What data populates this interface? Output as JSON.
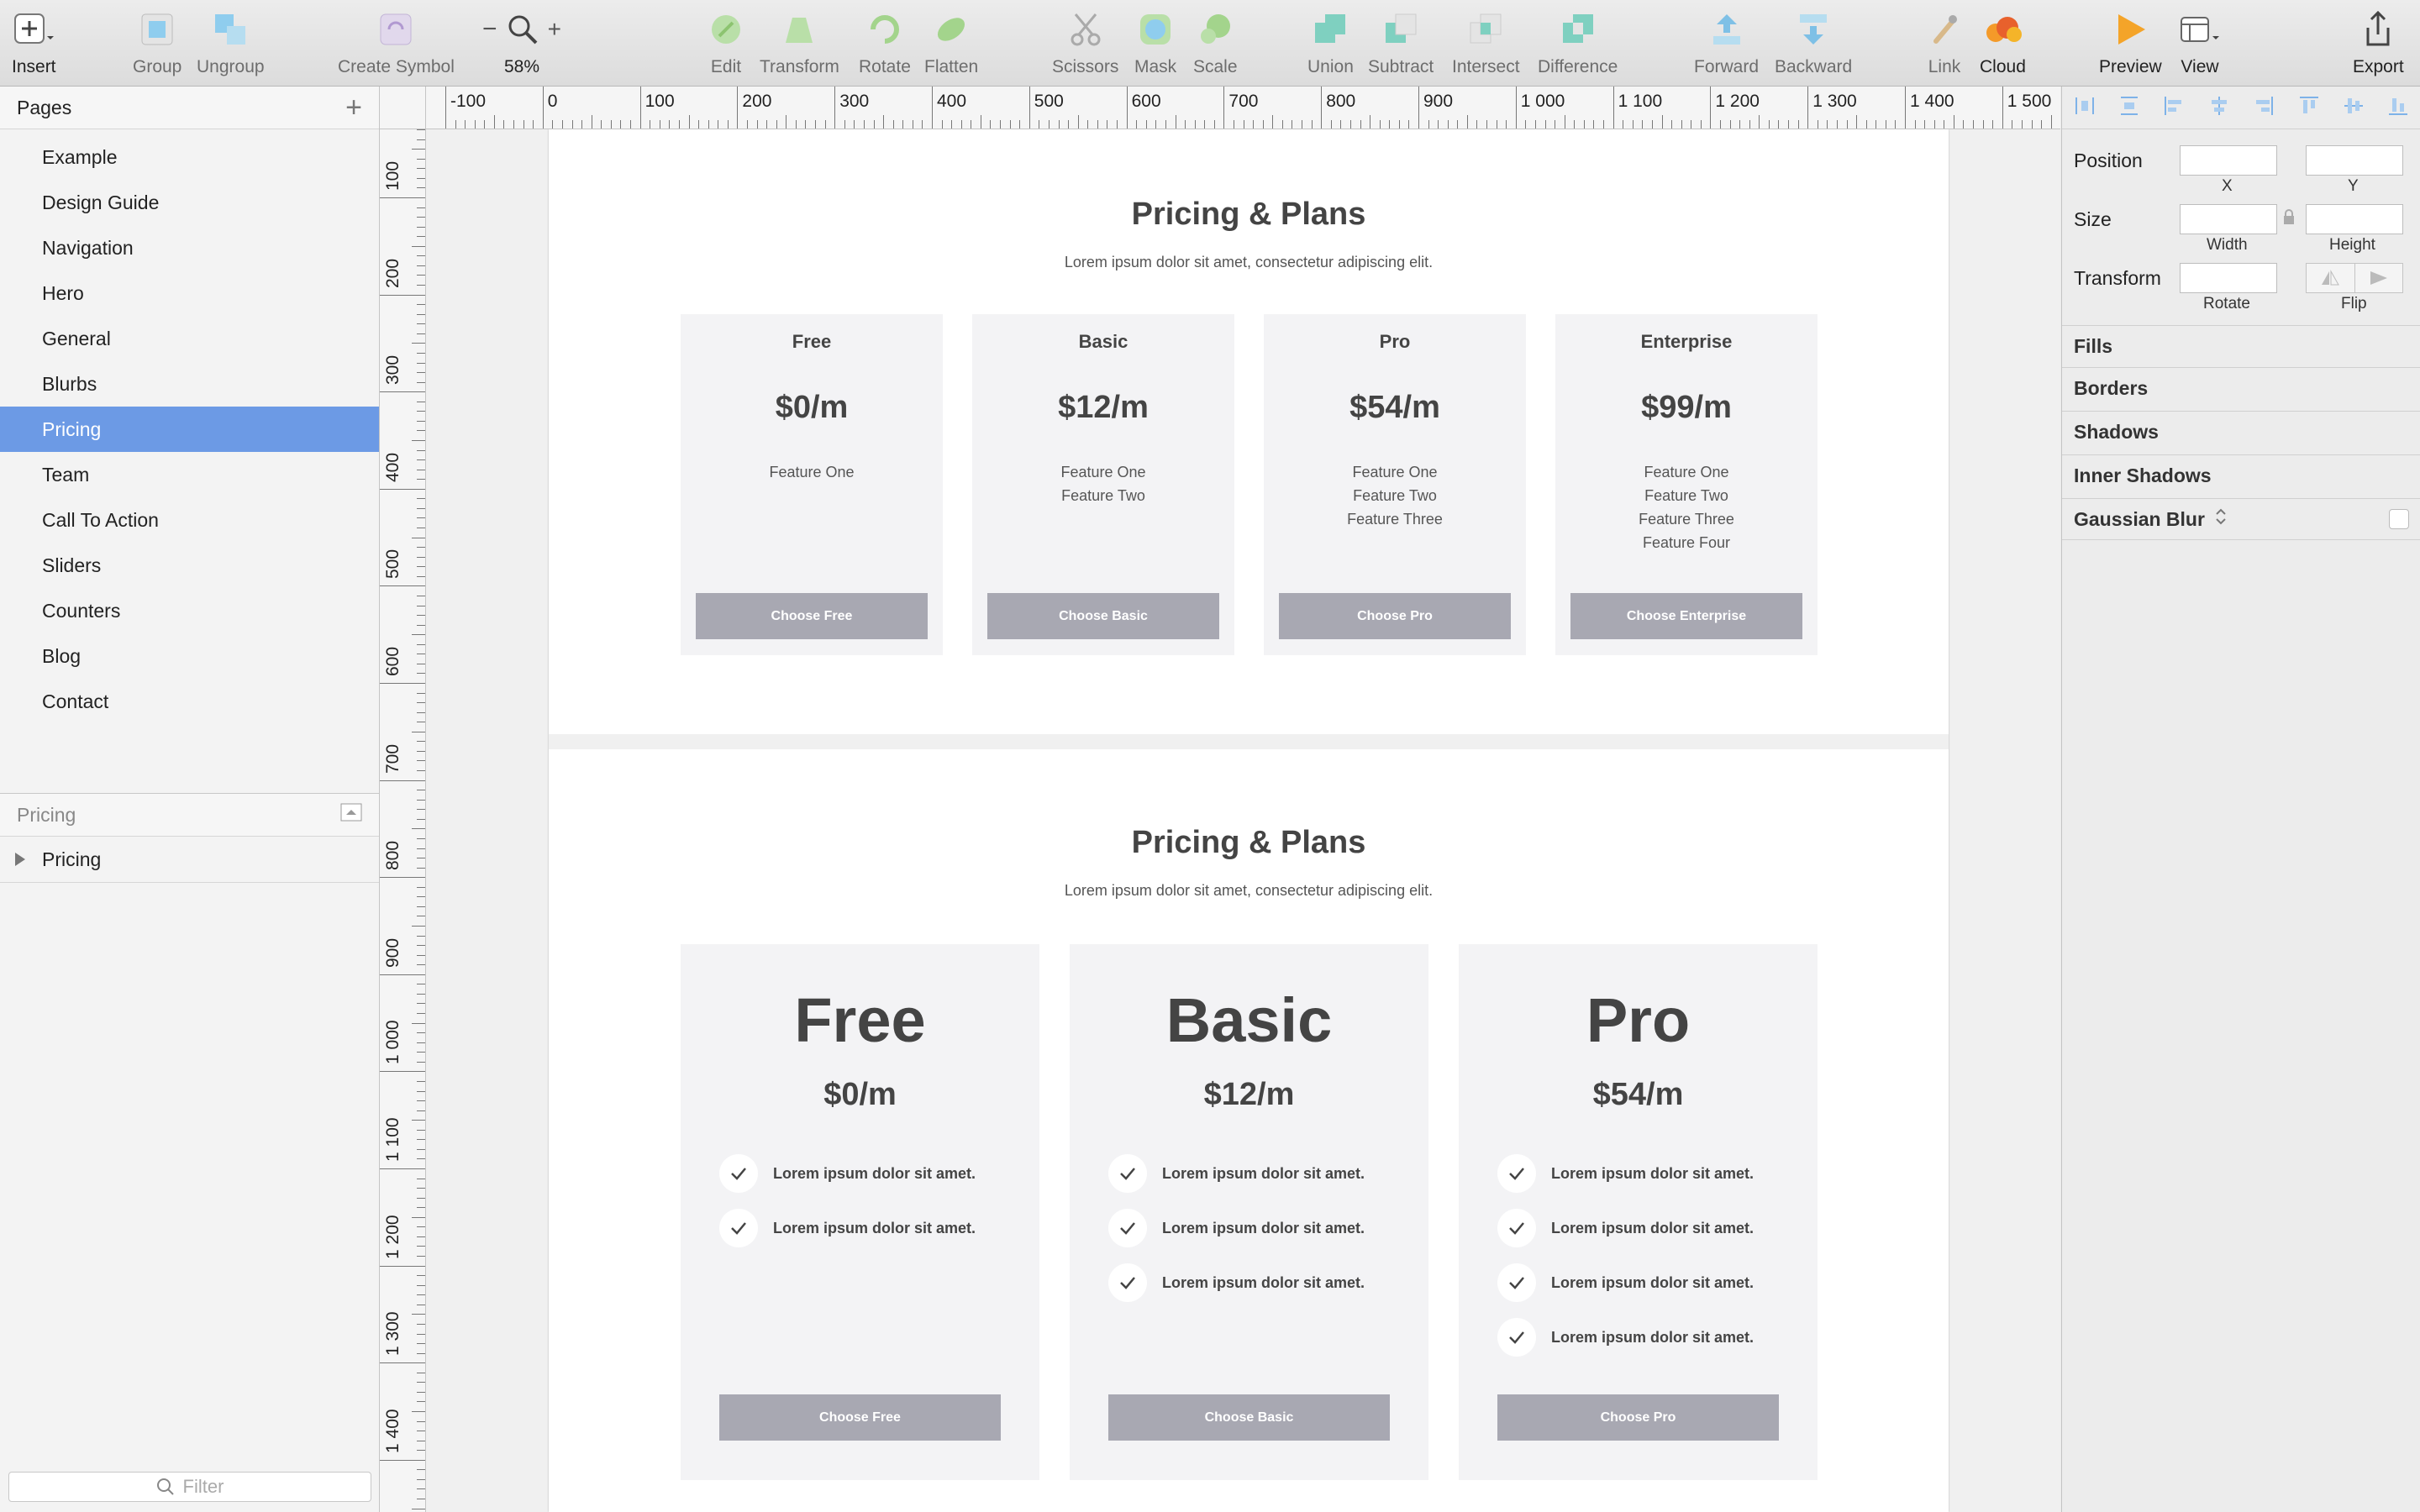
{
  "toolbar": {
    "insert": "Insert",
    "group": "Group",
    "ungroup": "Ungroup",
    "create_symbol": "Create Symbol",
    "zoom": "58%",
    "edit": "Edit",
    "transform": "Transform",
    "rotate": "Rotate",
    "flatten": "Flatten",
    "scissors": "Scissors",
    "mask": "Mask",
    "scale": "Scale",
    "union": "Union",
    "subtract": "Subtract",
    "intersect": "Intersect",
    "difference": "Difference",
    "forward": "Forward",
    "backward": "Backward",
    "link": "Link",
    "cloud": "Cloud",
    "preview": "Preview",
    "view": "View",
    "export": "Export"
  },
  "pages": {
    "header": "Pages",
    "items": [
      "Example",
      "Design Guide",
      "Navigation",
      "Hero",
      "General",
      "Blurbs",
      "Pricing",
      "Team",
      "Call To Action",
      "Sliders",
      "Counters",
      "Blog",
      "Contact"
    ],
    "selected": "Pricing"
  },
  "layers": {
    "header": "Pricing",
    "items": [
      "Pricing"
    ]
  },
  "filter": {
    "placeholder": "Filter"
  },
  "rulers": {
    "h": [
      "-100",
      "0",
      "100",
      "200",
      "300",
      "400",
      "500",
      "600",
      "700",
      "800",
      "900",
      "1 000",
      "1 100",
      "1 200",
      "1 300",
      "1 400",
      "1 500"
    ],
    "v": [
      "100",
      "200",
      "300",
      "400",
      "500",
      "600",
      "700",
      "800",
      "900",
      "1 000",
      "1 100",
      "1 200",
      "1 300",
      "1 400"
    ]
  },
  "section1": {
    "title": "Pricing & Plans",
    "subtitle": "Lorem ipsum dolor sit amet, consectetur adipiscing elit.",
    "cards": [
      {
        "name": "Free",
        "price": "$0/m",
        "features": [
          "Feature One"
        ],
        "button": "Choose Free"
      },
      {
        "name": "Basic",
        "price": "$12/m",
        "features": [
          "Feature One",
          "Feature Two"
        ],
        "button": "Choose Basic"
      },
      {
        "name": "Pro",
        "price": "$54/m",
        "features": [
          "Feature One",
          "Feature Two",
          "Feature Three"
        ],
        "button": "Choose Pro"
      },
      {
        "name": "Enterprise",
        "price": "$99/m",
        "features": [
          "Feature One",
          "Feature Two",
          "Feature Three",
          "Feature Four"
        ],
        "button": "Choose Enterprise"
      }
    ]
  },
  "section2": {
    "title": "Pricing & Plans",
    "subtitle": "Lorem ipsum dolor sit amet, consectetur adipiscing elit.",
    "cards": [
      {
        "name": "Free",
        "price": "$0/m",
        "features": [
          "Lorem ipsum dolor sit amet.",
          "Lorem ipsum dolor sit amet."
        ],
        "button": "Choose Free"
      },
      {
        "name": "Basic",
        "price": "$12/m",
        "features": [
          "Lorem ipsum dolor sit amet.",
          "Lorem ipsum dolor sit amet.",
          "Lorem ipsum dolor sit amet."
        ],
        "button": "Choose Basic"
      },
      {
        "name": "Pro",
        "price": "$54/m",
        "features": [
          "Lorem ipsum dolor sit amet.",
          "Lorem ipsum dolor sit amet.",
          "Lorem ipsum dolor sit amet.",
          "Lorem ipsum dolor sit amet."
        ],
        "button": "Choose Pro"
      }
    ]
  },
  "inspector": {
    "position": "Position",
    "x": "X",
    "y": "Y",
    "size": "Size",
    "width": "Width",
    "height": "Height",
    "transform": "Transform",
    "rotate": "Rotate",
    "flip": "Flip",
    "sections": [
      "Fills",
      "Borders",
      "Shadows",
      "Inner Shadows",
      "Gaussian Blur"
    ]
  },
  "colors": {
    "selection": "#6c9ae5",
    "button": "#a8a8b2",
    "card": "#f3f3f5"
  }
}
